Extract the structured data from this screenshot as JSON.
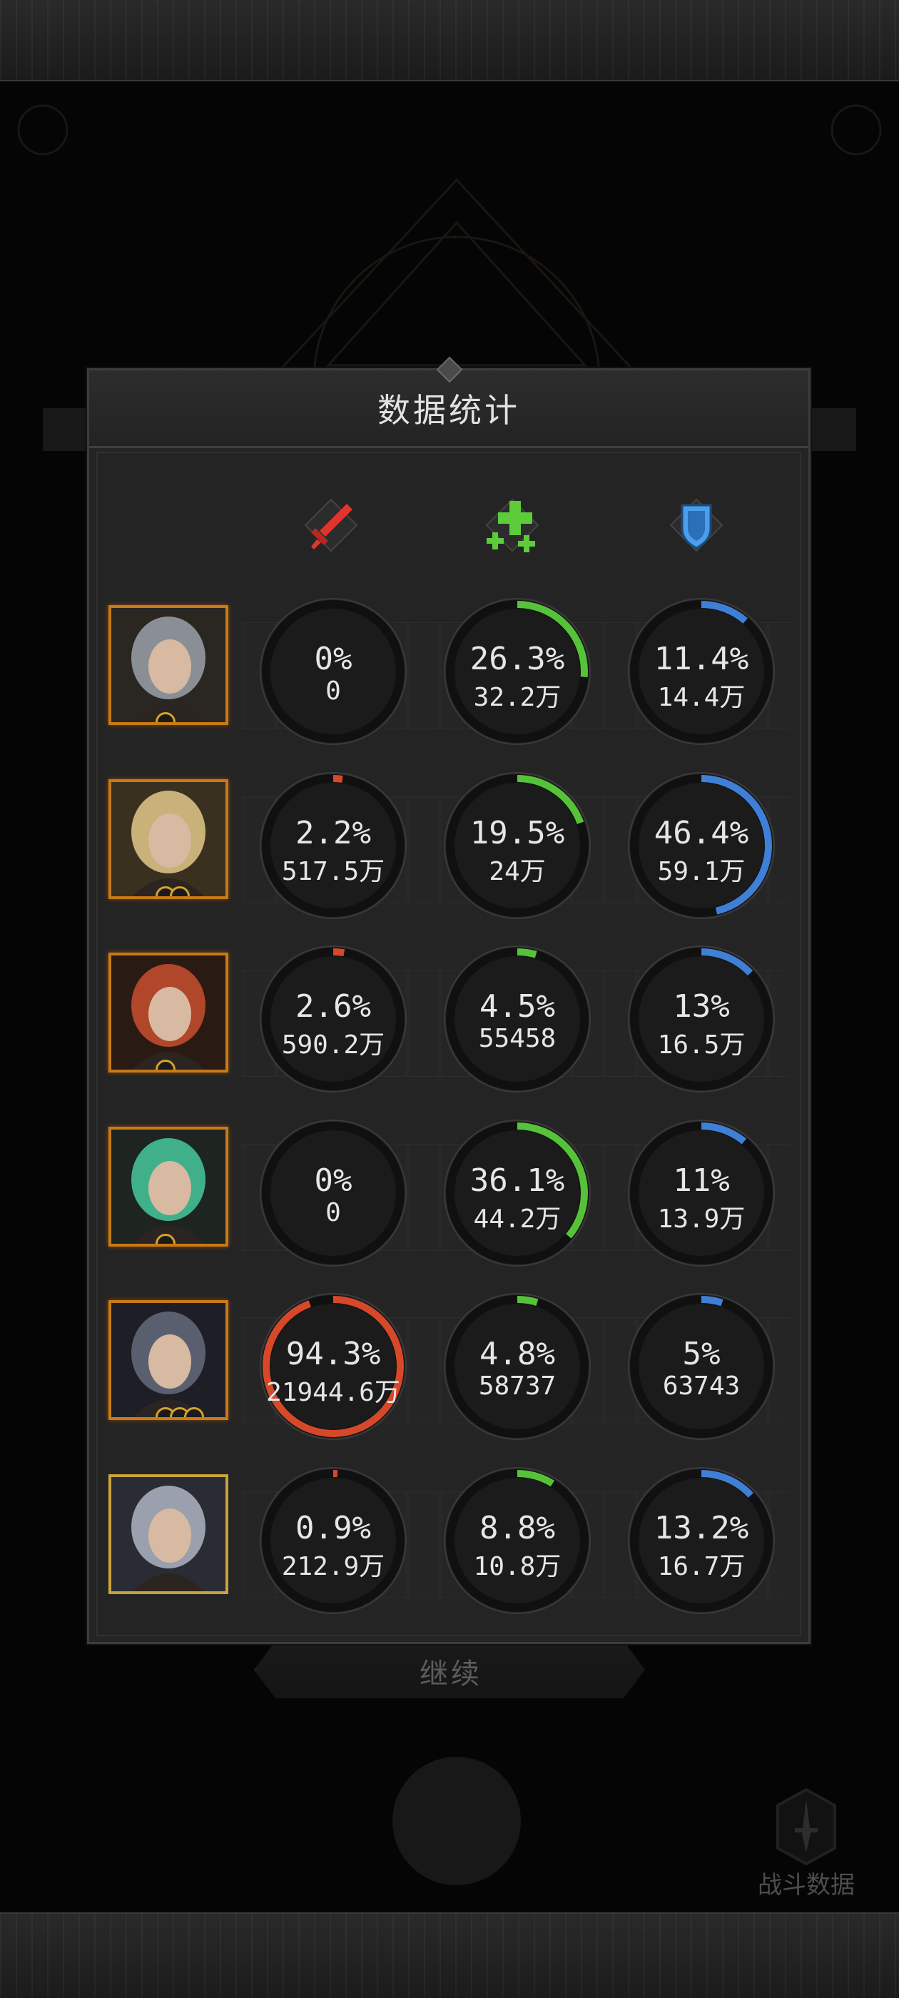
{
  "panel": {
    "title": "数据统计"
  },
  "continue_label": "继续",
  "battle_data_label": "战斗数据",
  "stat_icons": [
    {
      "name": "damage-sword-icon",
      "color": "#e0352b"
    },
    {
      "name": "heal-cross-icon",
      "color": "#5ccc3a"
    },
    {
      "name": "shield-icon",
      "color": "#4a9eea"
    }
  ],
  "colors": {
    "damage": "#d6482a",
    "heal": "#56c23a",
    "shield": "#3f7fd6"
  },
  "heroes": [
    {
      "avatar": "hero-1-portrait",
      "stars": 1,
      "damage": {
        "pct": "0%",
        "amount": "0",
        "value": 0
      },
      "heal": {
        "pct": "26.3%",
        "amount": "32.2万",
        "value": 26.3
      },
      "shield": {
        "pct": "11.4%",
        "amount": "14.4万",
        "value": 11.4
      }
    },
    {
      "avatar": "hero-2-portrait",
      "stars": 2,
      "damage": {
        "pct": "2.2%",
        "amount": "517.5万",
        "value": 2.2
      },
      "heal": {
        "pct": "19.5%",
        "amount": "24万",
        "value": 19.5
      },
      "shield": {
        "pct": "46.4%",
        "amount": "59.1万",
        "value": 46.4
      }
    },
    {
      "avatar": "hero-3-portrait",
      "stars": 1,
      "damage": {
        "pct": "2.6%",
        "amount": "590.2万",
        "value": 2.6
      },
      "heal": {
        "pct": "4.5%",
        "amount": "55458",
        "value": 4.5
      },
      "shield": {
        "pct": "13%",
        "amount": "16.5万",
        "value": 13
      }
    },
    {
      "avatar": "hero-4-portrait",
      "stars": 1,
      "damage": {
        "pct": "0%",
        "amount": "0",
        "value": 0
      },
      "heal": {
        "pct": "36.1%",
        "amount": "44.2万",
        "value": 36.1
      },
      "shield": {
        "pct": "11%",
        "amount": "13.9万",
        "value": 11
      }
    },
    {
      "avatar": "hero-5-portrait",
      "stars": 3,
      "damage": {
        "pct": "94.3%",
        "amount": "21944.6万",
        "value": 94.3
      },
      "heal": {
        "pct": "4.8%",
        "amount": "58737",
        "value": 4.8
      },
      "shield": {
        "pct": "5%",
        "amount": "63743",
        "value": 5
      }
    },
    {
      "avatar": "hero-6-portrait",
      "stars": 0,
      "damage": {
        "pct": "0.9%",
        "amount": "212.9万",
        "value": 0.9
      },
      "heal": {
        "pct": "8.8%",
        "amount": "10.8万",
        "value": 8.8
      },
      "shield": {
        "pct": "13.2%",
        "amount": "16.7万",
        "value": 13.2
      }
    }
  ]
}
